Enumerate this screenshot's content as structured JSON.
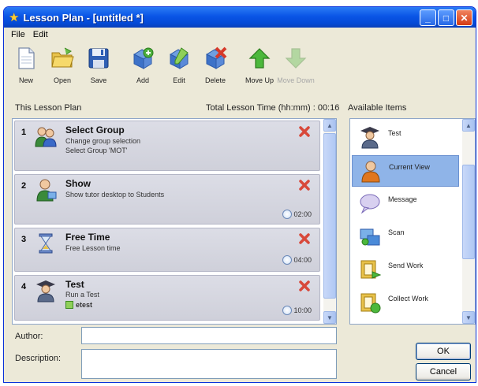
{
  "window": {
    "title": "Lesson Plan - [untitled *]",
    "star_icon": "star-icon"
  },
  "menu": [
    "File",
    "Edit"
  ],
  "toolbar": [
    {
      "label": "New",
      "icon": "new-document-icon",
      "enabled": true
    },
    {
      "label": "Open",
      "icon": "open-folder-icon",
      "enabled": true
    },
    {
      "label": "Save",
      "icon": "save-disk-icon",
      "enabled": true
    },
    {
      "label": "Add",
      "icon": "add-item-icon",
      "enabled": true
    },
    {
      "label": "Edit",
      "icon": "edit-item-icon",
      "enabled": true
    },
    {
      "label": "Delete",
      "icon": "delete-item-icon",
      "enabled": true
    },
    {
      "label": "Move Up",
      "icon": "move-up-icon",
      "enabled": true
    },
    {
      "label": "Move Down",
      "icon": "move-down-icon",
      "enabled": false
    }
  ],
  "plan": {
    "label": "This Lesson Plan",
    "total_time": "Total Lesson Time (hh:mm) : 00:16",
    "items": [
      {
        "number": "1",
        "title": "Select Group",
        "lines": [
          "Change group selection",
          "Select Group 'MOT'"
        ],
        "time": "",
        "icon": "group-icon"
      },
      {
        "number": "2",
        "title": "Show",
        "lines": [
          "Show tutor desktop to Students"
        ],
        "time": "02:00",
        "icon": "show-tutor-icon"
      },
      {
        "number": "3",
        "title": "Free Time",
        "lines": [
          "Free Lesson time"
        ],
        "time": "04:00",
        "icon": "hourglass-icon"
      },
      {
        "number": "4",
        "title": "Test",
        "lines": [
          "Run a Test",
          "etest"
        ],
        "time": "10:00",
        "icon": "test-graduate-icon"
      }
    ]
  },
  "available": {
    "label": "Available Items",
    "items": [
      {
        "label": "Test",
        "icon": "test-graduate-icon",
        "selected": false
      },
      {
        "label": "Current View",
        "icon": "current-view-icon",
        "selected": true
      },
      {
        "label": "Message",
        "icon": "message-bubble-icon",
        "selected": false
      },
      {
        "label": "Scan",
        "icon": "scan-icon",
        "selected": false
      },
      {
        "label": "Send Work",
        "icon": "send-work-icon",
        "selected": false
      },
      {
        "label": "Collect Work",
        "icon": "collect-work-icon",
        "selected": false
      }
    ]
  },
  "form": {
    "author_label": "Author:",
    "author_value": "",
    "description_label": "Description:",
    "description_value": ""
  },
  "buttons": {
    "ok": "OK",
    "cancel": "Cancel"
  },
  "colors": {
    "titlebar": "#0a55e6",
    "selection": "#8fb4e8",
    "item_bg": "#d4d5df",
    "window_bg": "#ece9d8"
  }
}
